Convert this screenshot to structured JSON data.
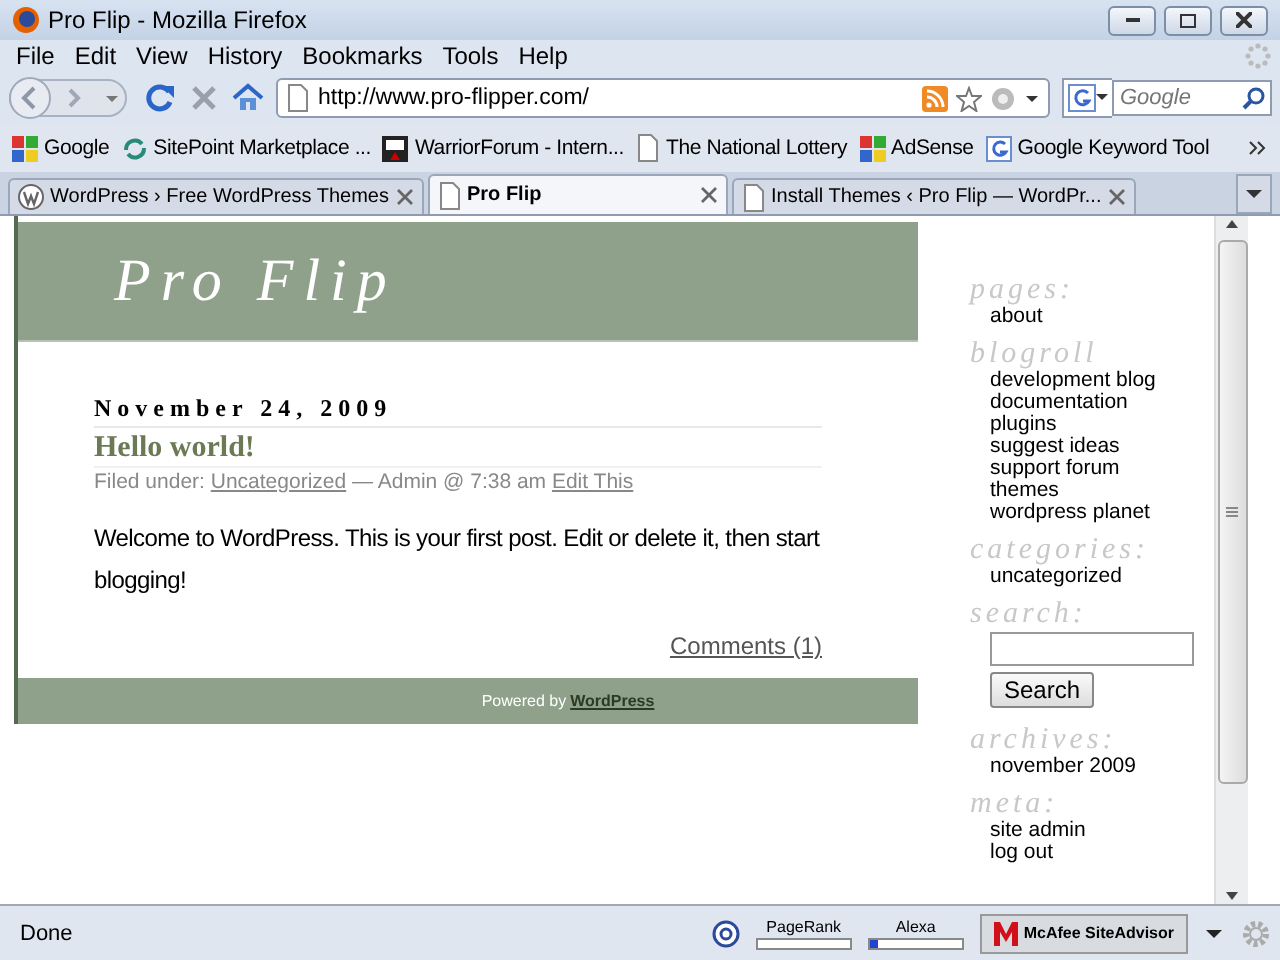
{
  "window": {
    "title": "Pro Flip - Mozilla Firefox"
  },
  "menu_bar": [
    "File",
    "Edit",
    "View",
    "History",
    "Bookmarks",
    "Tools",
    "Help"
  ],
  "nav_bar": {
    "url": "http://www.pro-flipper.com/",
    "search_placeholder": "Google"
  },
  "bookmarks": [
    "Google",
    "SitePoint Marketplace ...",
    "WarriorForum - Intern...",
    "The National Lottery",
    "AdSense",
    "Google Keyword Tool"
  ],
  "tabs": [
    {
      "label": "WordPress › Free WordPress Themes",
      "selected": false
    },
    {
      "label": "Pro Flip",
      "selected": true
    },
    {
      "label": "Install Themes ‹ Pro Flip — WordPr...",
      "selected": false
    }
  ],
  "page": {
    "site_title": "Pro Flip",
    "post": {
      "date": "November 24, 2009",
      "title": "Hello world!",
      "filed_under": "Filed under:",
      "category_link": "Uncategorized",
      "byline": "— Admin @ 7:38 am",
      "edit_link": "Edit This",
      "body": "Welcome to WordPress. This is your first post. Edit or delete it, then start blogging!",
      "comments_link": "Comments (1)"
    },
    "footer": {
      "prefix": "Powered by",
      "link": "WordPress"
    },
    "sidebar": [
      {
        "kind": "links",
        "heading": "pages:",
        "items": [
          "about"
        ]
      },
      {
        "kind": "links",
        "heading": "blogroll",
        "items": [
          "development blog",
          "documentation",
          "plugins",
          "suggest ideas",
          "support forum",
          "themes",
          "wordpress planet"
        ]
      },
      {
        "kind": "links",
        "heading": "categories:",
        "items": [
          "uncategorized"
        ]
      },
      {
        "kind": "search",
        "heading": "search:",
        "button": "Search"
      },
      {
        "kind": "links",
        "heading": "archives:",
        "items": [
          "november 2009"
        ]
      },
      {
        "kind": "links",
        "heading": "meta:",
        "items": [
          "site admin",
          "log out"
        ]
      }
    ]
  },
  "status_bar": {
    "text": "Done",
    "pagerank": {
      "label": "PageRank",
      "level": 0
    },
    "alexa": {
      "label": "Alexa",
      "level": 0.08
    },
    "siteadvisor": "McAfee SiteAdvisor"
  }
}
